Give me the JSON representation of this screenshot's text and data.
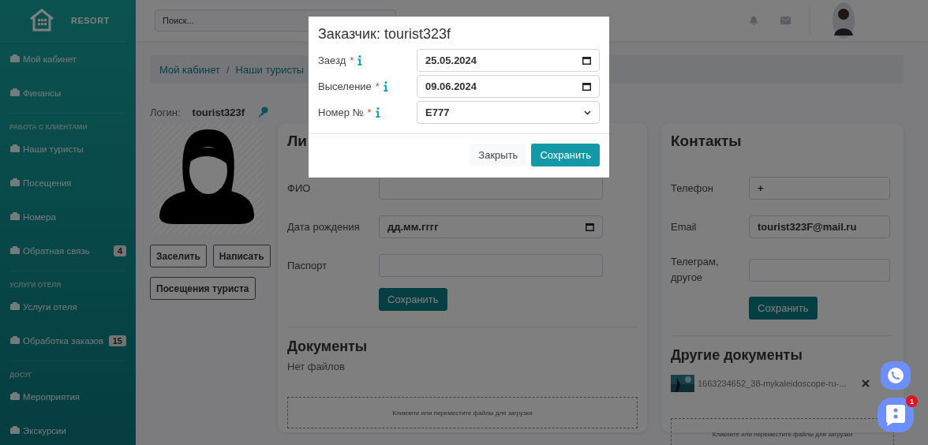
{
  "sidebar": {
    "brand": "RESORT",
    "items": [
      {
        "kind": "item",
        "label": "Мой кабинет"
      },
      {
        "kind": "item",
        "label": "Финансы"
      },
      {
        "kind": "heading",
        "label": "РАБОТА С КЛИЕНТАМИ"
      },
      {
        "kind": "item",
        "label": "Наши туристы"
      },
      {
        "kind": "item",
        "label": "Посещения"
      },
      {
        "kind": "item",
        "label": "Номера"
      },
      {
        "kind": "item",
        "label": "Обратная связь",
        "badge": "4"
      },
      {
        "kind": "heading",
        "label": "УСЛУГИ ОТЕЛЯ"
      },
      {
        "kind": "item",
        "label": "Услуги отеля"
      },
      {
        "kind": "item",
        "label": "Обработка заказов",
        "badge": "15"
      },
      {
        "kind": "heading",
        "label": "ДОСУГ"
      },
      {
        "kind": "item",
        "label": "Мероприятия"
      },
      {
        "kind": "item",
        "label": "Экскурсии"
      }
    ]
  },
  "topbar": {
    "search": {
      "placeholder": "Поиск..."
    }
  },
  "breadcrumb": {
    "separator": "/",
    "items": [
      "Мой кабинет",
      "Наши туристы"
    ]
  },
  "login": {
    "label": "Логин:",
    "value": "tourist323f"
  },
  "actions": [
    "Заселить",
    "Написать",
    "Посещения туриста"
  ],
  "personal": {
    "title": "Ли",
    "fields": [
      {
        "label": "ФИО"
      },
      {
        "label": "Дата рождения",
        "value": "дд.мм.гггг",
        "kind": "date"
      },
      {
        "label": "Паспорт"
      }
    ],
    "save": "Сохранить",
    "docs_title": "Документы",
    "docs_empty": "Нет файлов",
    "dropzone": "Кликните или переместите файлы для загрузки"
  },
  "contacts": {
    "title": "Контакты",
    "fields": [
      {
        "label": "Телефон",
        "value": "+"
      },
      {
        "label": "Email",
        "value": "tourist323F@mail.ru"
      },
      {
        "label": "Телеграм, другое"
      }
    ],
    "save": "Сохранить",
    "docs_title": "Другие документы",
    "file": "1663234652_38-mykaleidoscope-ru-...",
    "dropzone": "Кликните или переместите файлы для загрузки"
  },
  "chat": {
    "badge": "1"
  },
  "modal": {
    "title": "Заказчик: tourist323f",
    "required_mark": "*",
    "fields": [
      {
        "label": "Заезд",
        "required": true,
        "kind": "date",
        "value": "25.05.2024"
      },
      {
        "label": "Выселение",
        "required": true,
        "kind": "date",
        "value": "09.06.2024"
      },
      {
        "label": "Номер №",
        "required": true,
        "kind": "select",
        "value": "E777"
      }
    ],
    "buttons": [
      {
        "label": "Закрыть",
        "kind": "secondary"
      },
      {
        "label": "Сохранить",
        "kind": "primary"
      }
    ]
  }
}
